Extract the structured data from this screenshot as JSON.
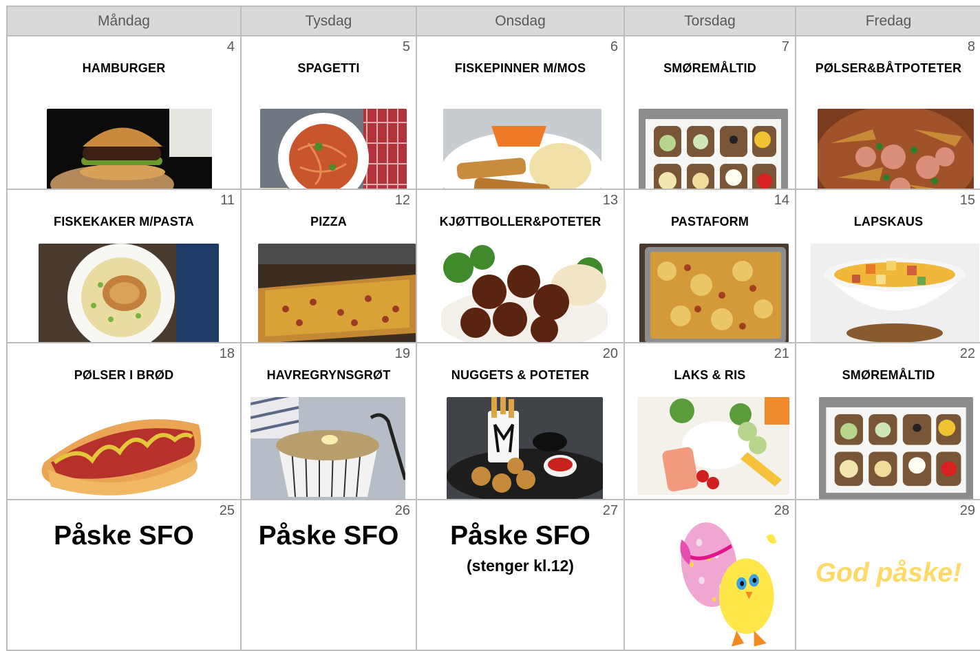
{
  "weekdays": [
    "Måndag",
    "Tysdag",
    "Onsdag",
    "Torsdag",
    "Fredag"
  ],
  "weeks": [
    [
      {
        "day": "4",
        "meal": "HAMBURGER",
        "image": "hamburger-photo"
      },
      {
        "day": "5",
        "meal": "SPAGETTI",
        "image": "spaghetti-photo"
      },
      {
        "day": "6",
        "meal": "FISKEPINNER M/MOS",
        "image": "fish-sticks-mash-photo"
      },
      {
        "day": "7",
        "meal": "SMØREMÅLTID",
        "image": "open-sandwiches-photo"
      },
      {
        "day": "8",
        "meal": "PØLSER&BÅTPOTETER",
        "image": "sausages-potato-wedges-photo"
      }
    ],
    [
      {
        "day": "11",
        "meal": "FISKEKAKER M/PASTA",
        "image": "fish-cakes-pasta-photo"
      },
      {
        "day": "12",
        "meal": "PIZZA",
        "image": "pizza-photo"
      },
      {
        "day": "13",
        "meal": "KJØTTBOLLER&POTETER",
        "image": "meatballs-photo"
      },
      {
        "day": "14",
        "meal": "PASTAFORM",
        "image": "pasta-bake-photo"
      },
      {
        "day": "15",
        "meal": "LAPSKAUS",
        "image": "stew-bowl-photo"
      }
    ],
    [
      {
        "day": "18",
        "meal": "PØLSER I BRØD",
        "image": "hotdog-photo"
      },
      {
        "day": "19",
        "meal": "HAVREGRYNSGRØT",
        "image": "oatmeal-photo"
      },
      {
        "day": "20",
        "meal": "NUGGETS & POTETER",
        "image": "nuggets-fries-photo"
      },
      {
        "day": "21",
        "meal": "LAKS & RIS",
        "image": "salmon-rice-photo"
      },
      {
        "day": "22",
        "meal": "SMØREMÅLTID",
        "image": "open-sandwiches-photo"
      }
    ],
    [
      {
        "day": "25",
        "title": "Påske SFO"
      },
      {
        "day": "26",
        "title": "Påske SFO"
      },
      {
        "day": "27",
        "title": "Påske SFO",
        "subtitle": "(stenger kl.12)"
      },
      {
        "day": "28",
        "image": "easter-chick-illustration"
      },
      {
        "day": "29",
        "greeting": "God påske!"
      }
    ]
  ],
  "colors": {
    "header_bg": "#d9d9d9",
    "grid_line": "#bdbdbd",
    "day_number": "#595959",
    "greeting": "#ffd966"
  }
}
